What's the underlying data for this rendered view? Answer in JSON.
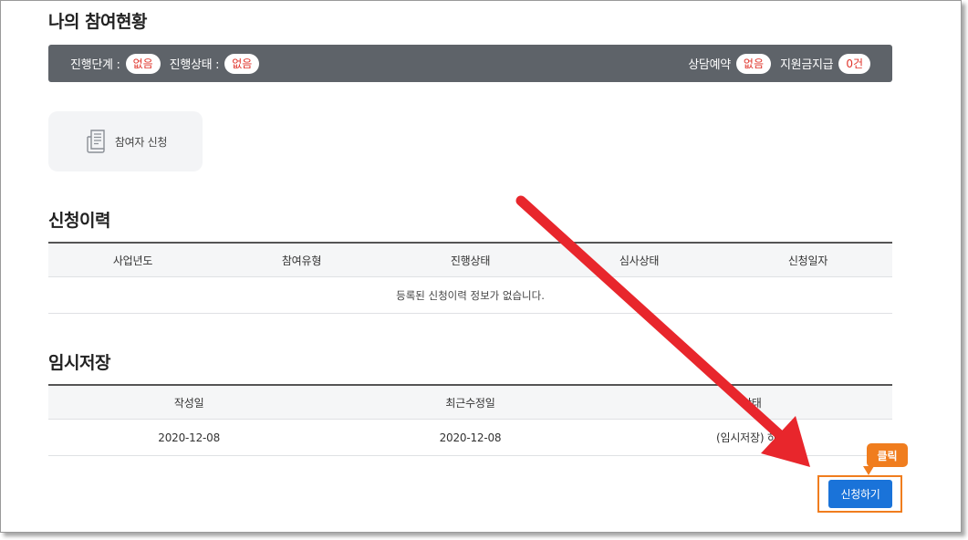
{
  "participation": {
    "title": "나의 참여현황",
    "status_bar": {
      "left": [
        {
          "label": "진행단계 :",
          "value": "없음"
        },
        {
          "label": "진행상태 :",
          "value": "없음"
        }
      ],
      "right": [
        {
          "label": "상담예약",
          "value": "없음"
        },
        {
          "label": "지원금지급",
          "value": "0건"
        }
      ]
    },
    "apply_card_label": "참여자 신청",
    "apply_card_icon": "document-icon"
  },
  "history": {
    "title": "신청이력",
    "columns": [
      "사업년도",
      "참여유형",
      "진행상태",
      "심사상태",
      "신청일자"
    ],
    "empty_message": "등록된 신청이력 정보가 없습니다."
  },
  "temp_save": {
    "title": "임시저장",
    "columns": [
      "작성일",
      "최근수정일",
      "상태"
    ],
    "rows": [
      {
        "created": "2020-12-08",
        "modified": "2020-12-08",
        "status": "(임시저장) 하기"
      }
    ]
  },
  "apply_button_label": "신청하기",
  "callout_label": "클릭",
  "colors": {
    "status_bar_bg": "#5e6369",
    "pill_text": "#e0342b",
    "button_primary": "#1a73d9",
    "annotation_orange": "#f07d1e",
    "arrow_red": "#e8262c"
  }
}
